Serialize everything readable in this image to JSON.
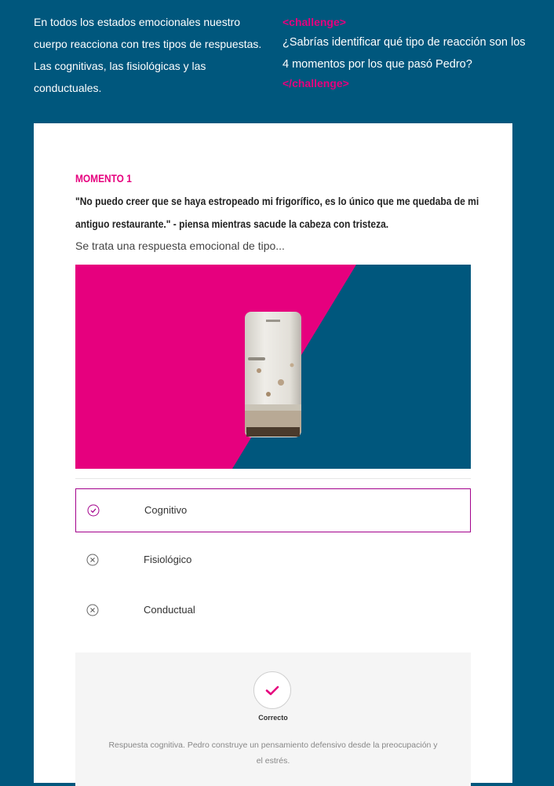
{
  "intro": {
    "text": "En todos los estados emocionales nuestro cuerpo reacciona con tres tipos de respuestas. Las cognitivas, las fisiológicas y las conductuales."
  },
  "challenge": {
    "open_tag": "<challenge>",
    "question": "¿Sabrías identificar qué tipo de reacción son los 4 momentos por los que pasó Pedro?",
    "close_tag": "</challenge>"
  },
  "card": {
    "moment_title": "MOMENTO 1",
    "quote": "\"No puedo creer que se haya estropeado mi frigorífico, es lo único que me quedaba de mi antiguo restaurante.\" - piensa mientras sacude la cabeza con tristeza.",
    "prompt": "Se trata una respuesta emocional de tipo...",
    "image_icon": "old-refrigerator-image"
  },
  "options": [
    {
      "label": "Cognitivo",
      "icon": "check-circle-icon",
      "selected": true
    },
    {
      "label": "Fisiológico",
      "icon": "x-circle-icon",
      "selected": false
    },
    {
      "label": "Conductual",
      "icon": "x-circle-icon",
      "selected": false
    }
  ],
  "feedback": {
    "status": "Correcto",
    "text": "Respuesta cognitiva. Pedro construye un pensamiento defensivo  desde la preocupación y el estrés.",
    "icon": "check-icon"
  },
  "colors": {
    "background": "#00577d",
    "accent": "#e6007e",
    "selected_border": "#a3008c"
  }
}
